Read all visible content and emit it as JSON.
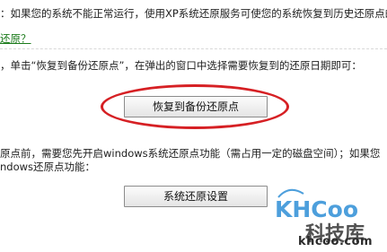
{
  "text": {
    "line1": "：如果您的系统不能正常运行，使用XP系统还原服务可使您的系统恢复到历史还原点的正",
    "line2": "还原？",
    "line3": "，单击“恢复到备份还原点”，在弹出的窗口中选择需要恢复到的还原日期即可：",
    "line4": "原点前，需要您先开启windows系统还原点功能（需占用一定的磁盘空间）；如果您",
    "line5": "ndows还原点功能："
  },
  "buttons": {
    "restore_backup": "恢复到备份还原点",
    "restore_settings": "系统还原设置"
  },
  "watermark": {
    "logo_text": "KHCoo",
    "cn_text": "科技库",
    "url": "khcoo.com"
  },
  "colors": {
    "highlight": "#d62024",
    "link": "#1a7a1a",
    "brand_blue": "#2f8fd6"
  }
}
